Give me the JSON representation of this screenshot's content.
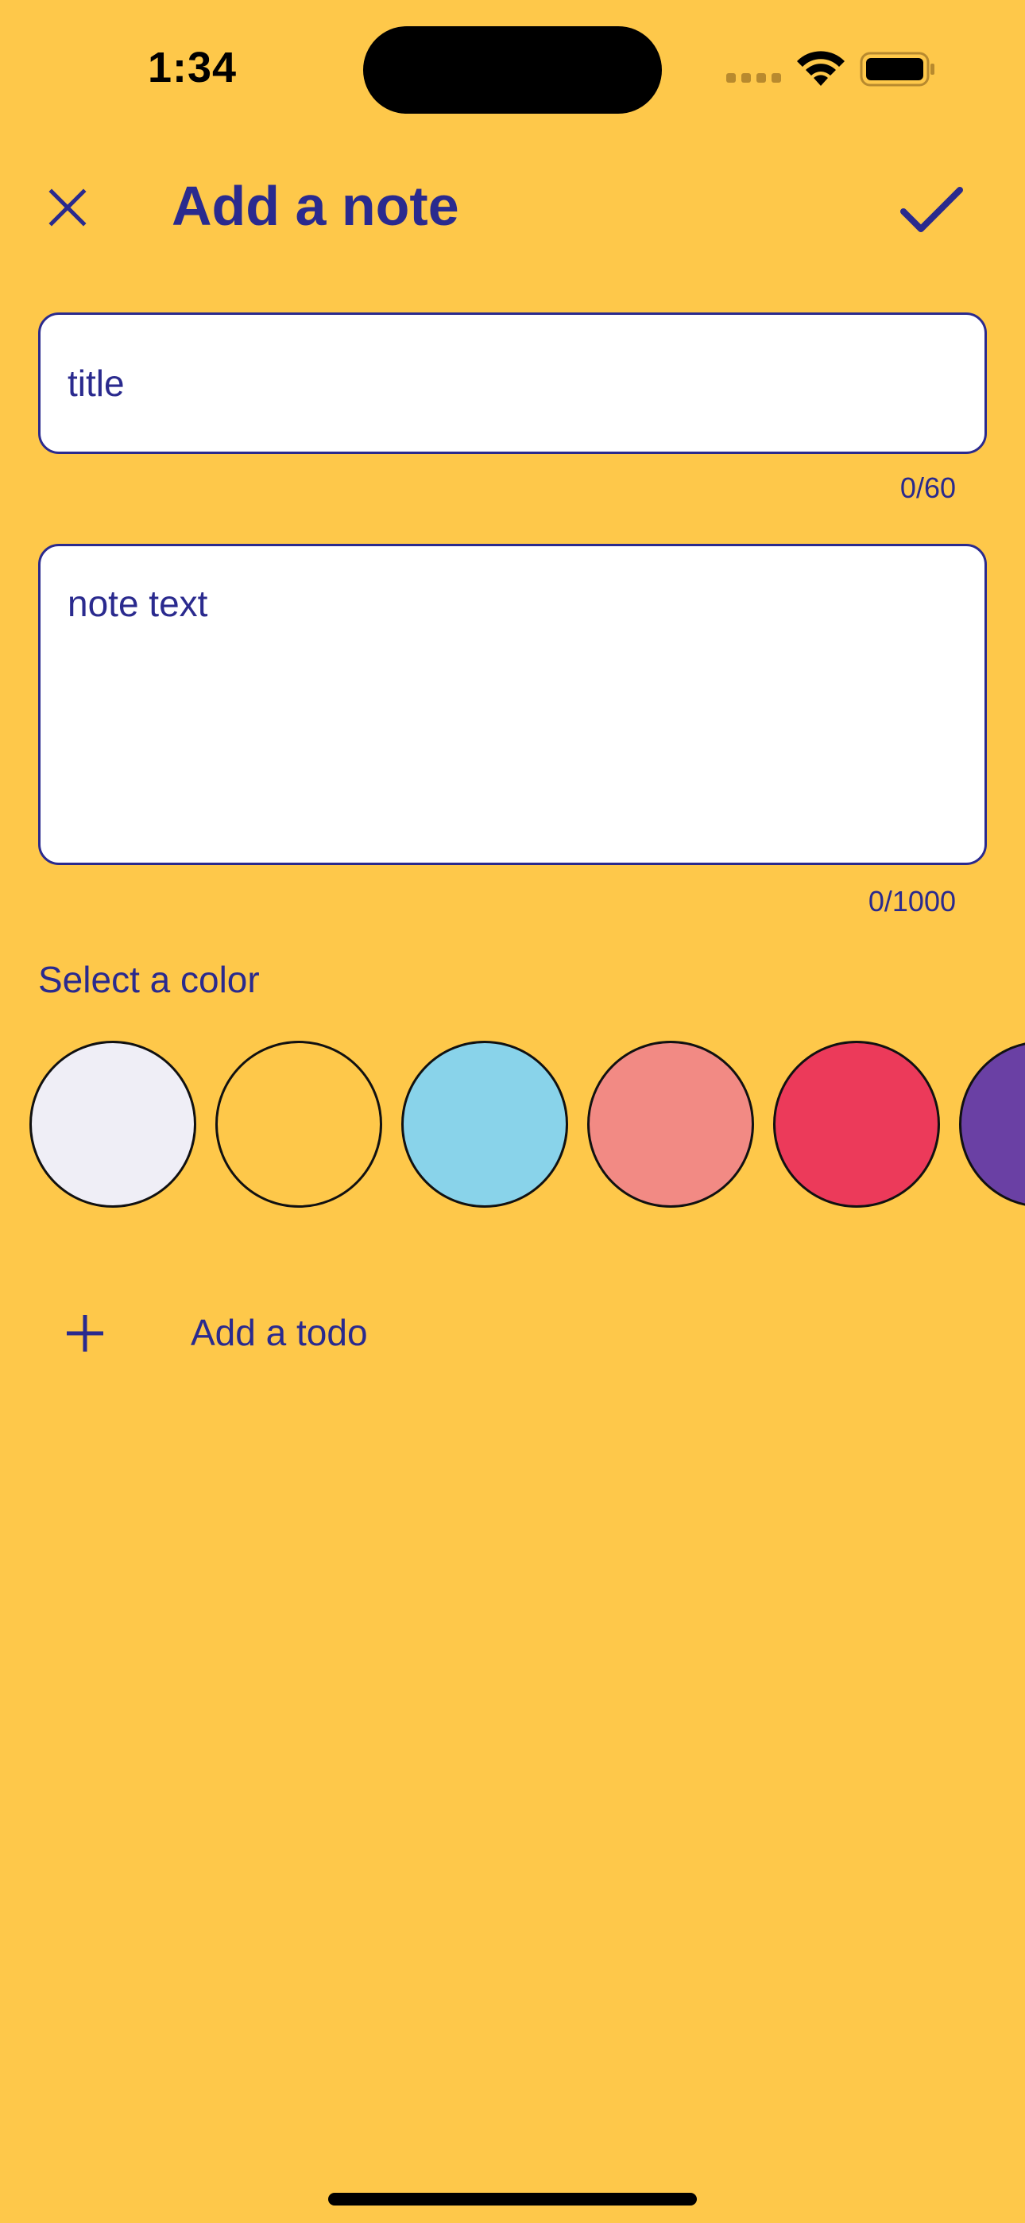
{
  "status_bar": {
    "time": "1:34"
  },
  "header": {
    "title": "Add a note",
    "close_icon": "close-icon",
    "confirm_icon": "checkmark-icon"
  },
  "form": {
    "title_field": {
      "value": "",
      "placeholder": "title",
      "counter": "0/60"
    },
    "note_field": {
      "value": "",
      "placeholder": "note text",
      "counter": "0/1000"
    }
  },
  "color_select": {
    "label": "Select a color",
    "options": [
      {
        "name": "light-lavender",
        "color": "#EFEEF6"
      },
      {
        "name": "yellow",
        "color": "#FEC84A"
      },
      {
        "name": "sky-blue",
        "color": "#89D3EA"
      },
      {
        "name": "salmon",
        "color": "#F28A84"
      },
      {
        "name": "red",
        "color": "#EC3A5A"
      },
      {
        "name": "purple",
        "color": "#6A40A4"
      }
    ]
  },
  "add_todo": {
    "label": "Add a todo",
    "icon": "plus-icon"
  },
  "theme": {
    "background": "#FEC84A",
    "accent": "#2A2A8E"
  }
}
